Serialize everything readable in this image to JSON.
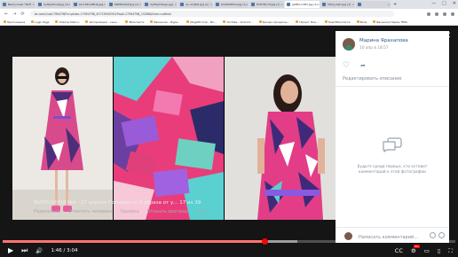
{
  "browser": {
    "tabs": [
      {
        "label": "Выпускник *КУН",
        "active": false
      },
      {
        "label": "Vy0ky9knuf.jpg (1)",
        "active": false
      },
      {
        "label": "bk-Y-Pbno8fUw.jpg",
        "active": false
      },
      {
        "label": "KRPtOQYuF.jpg (1)",
        "active": false
      },
      {
        "label": "VySfqUn6ogo.jpg",
        "active": false
      },
      {
        "label": "u1-uYg5Ki.jpg (1)",
        "active": false
      },
      {
        "label": "GCa0bf6Shi.jpg (1)",
        "active": false
      },
      {
        "label": "MrHYMrurf.jpg (1)",
        "active": false
      },
      {
        "label": "gAfR0-13R3.jpg (1)",
        "active": true
      },
      {
        "label": "VZUyj.byh.jpg (1)",
        "active": false
      },
      {
        "label": "",
        "active": false
      }
    ],
    "new_tab": "+",
    "window_controls": {
      "minimize": "—",
      "maximize": "□",
      "close": "✕"
    },
    "nav": {
      "back": "←",
      "forward": "→",
      "reload": "⟳"
    },
    "url": "vk.com/club17994798?z=photo-17994798_457239943%2Fwall-17994798_15268&from=nofeed",
    "bookmarks": [
      "Приложения",
      "Login Page",
      "Ответы Mail.ru",
      "Авторизация - кино…",
      "ВКонтакте",
      "Вакансии - Журн…",
      "MegaFit Club - Мо…",
      "YouTube - Android…",
      "Бизнес-процессы…",
      "Проект Фон…",
      "Ещё ВКонтакте",
      "Вход",
      "Вакансии Пермь TERA"
    ]
  },
  "viewer": {
    "close_label": "✕",
    "author": "Марина Ярахапова",
    "date": "10 апр в 18:57",
    "like_icon": "♡",
    "share_icon": "➦",
    "edit_description": "Редактировать описание",
    "empty_comments": "Будьте среди первых, кто оставит комментарий к этой фотографии",
    "comment_placeholder": "Написать комментарий...",
    "caption": "ВЫПУСКНОЙ №4 - 27 апреля Готовим по 3 образа от у... 17 из 39",
    "actions": [
      "Поделиться",
      "Отметить человека",
      "Удалить",
      "Открыть оригинал",
      "Ещё ⌄"
    ]
  },
  "player": {
    "play_icon": "▶",
    "next_icon": "⏭",
    "volume_icon": "🔊",
    "time": "1:46 / 3:04",
    "progress": 0.58,
    "buffered": 0.65,
    "right_icons": [
      "⚙",
      "▭",
      "▯",
      "⛶"
    ],
    "subtitles_icon": "CC"
  },
  "colors": {
    "vk_blue": "#2a5885",
    "gray_text": "#818c99",
    "yt_red": "#ff0000"
  }
}
